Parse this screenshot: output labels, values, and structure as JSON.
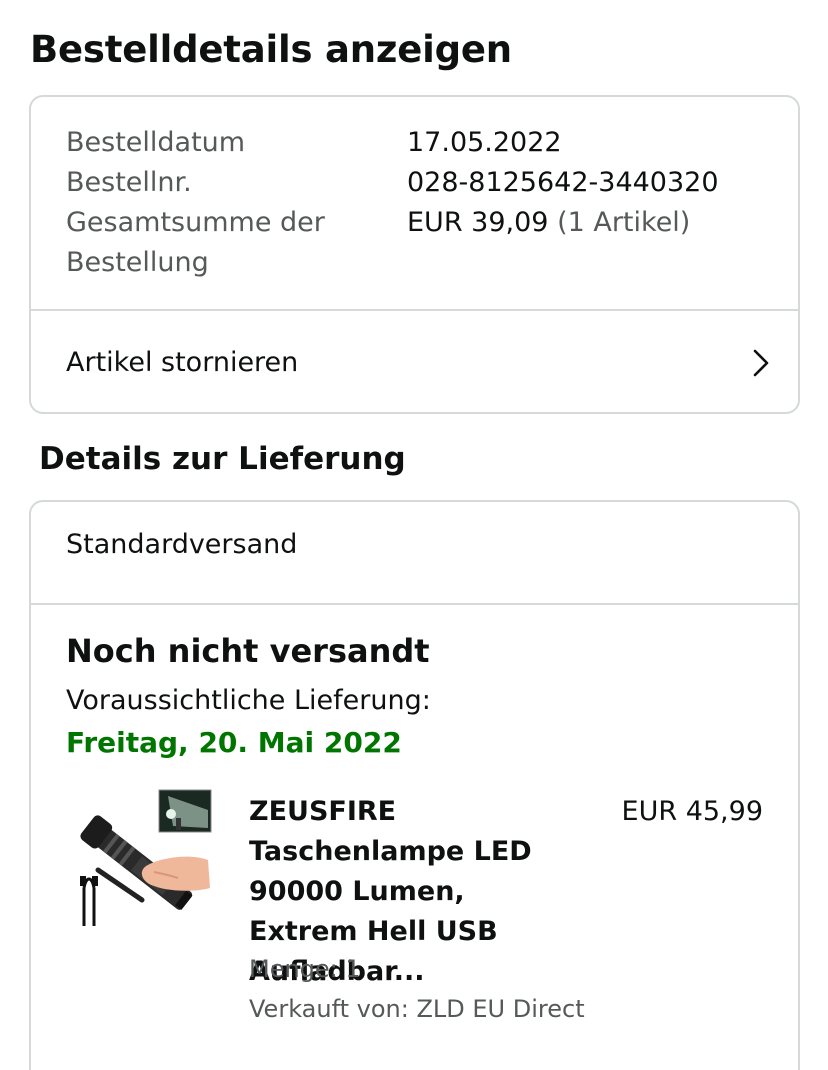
{
  "page": {
    "title": "Bestelldetails anzeigen"
  },
  "order_summary": {
    "date_label": "Bestelldatum",
    "date_value": "17.05.2022",
    "number_label": "Bestellnr.",
    "number_value": "028-8125642-3440320",
    "total_label_line1": "Gesamtsumme der",
    "total_label_line2": "Bestellung",
    "total_value": "EUR 39,09",
    "total_items": "(1 Artikel)"
  },
  "actions": {
    "cancel_label": "Artikel stornieren"
  },
  "delivery": {
    "heading": "Details zur Lieferung",
    "shipping_method": "Standardversand",
    "status": "Noch nicht versandt",
    "estimated_label": "Voraussichtliche Lieferung:",
    "estimated_date": "Freitag, 20. Mai 2022",
    "accent_color": "#007600"
  },
  "product": {
    "title": "ZEUSFIRE Taschenlampe LED 90000 Lumen, Extrem Hell USB Aufladbar...",
    "price": "EUR 45,99",
    "quantity": "Menge: 1",
    "seller": "Verkauft von: ZLD EU Direct",
    "image_icon": "flashlight-product-image"
  }
}
